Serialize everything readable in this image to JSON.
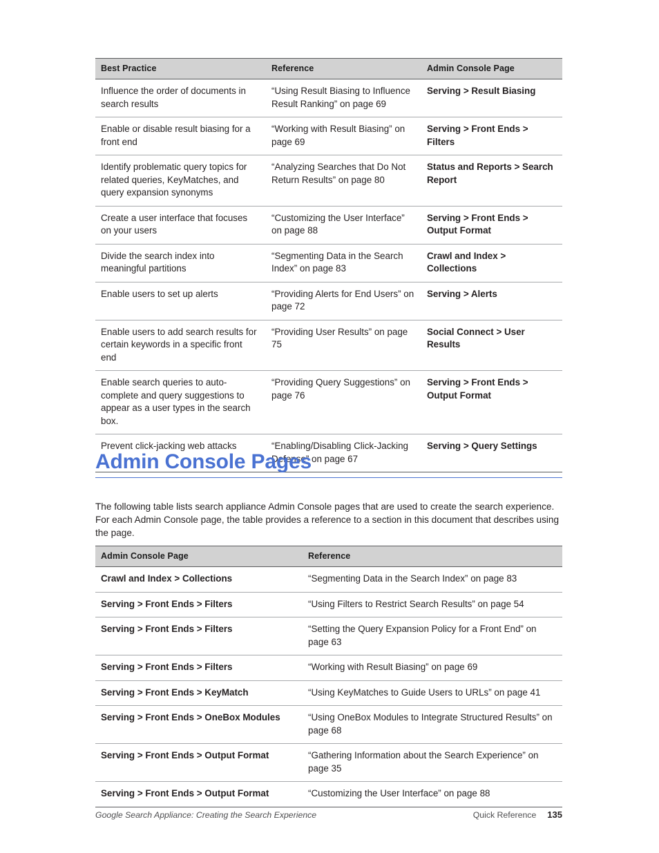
{
  "best_practice_table": {
    "columns": [
      "Best Practice",
      "Reference",
      "Admin Console Page"
    ],
    "rows": [
      {
        "best_practice": "Influence the order of documents in search results",
        "reference": "“Using Result Biasing to Influence Result Ranking” on page 69",
        "admin_console_page": "Serving > Result Biasing"
      },
      {
        "best_practice": "Enable or disable result biasing for a front end",
        "reference": "“Working with Result Biasing” on page 69",
        "admin_console_page": "Serving > Front Ends > Filters"
      },
      {
        "best_practice": "Identify problematic query topics for related queries, KeyMatches, and query expansion synonyms",
        "reference": "“Analyzing Searches that Do Not Return Results” on page 80",
        "admin_console_page": "Status and Reports > Search Report"
      },
      {
        "best_practice": "Create a user interface that focuses on your users",
        "reference": "“Customizing the User Interface” on page 88",
        "admin_console_page": "Serving > Front Ends > Output Format"
      },
      {
        "best_practice": "Divide the search index into meaningful partitions",
        "reference": "“Segmenting Data in the Search Index” on page 83",
        "admin_console_page": "Crawl and Index > Collections"
      },
      {
        "best_practice": "Enable users to set up alerts",
        "reference": "“Providing Alerts for End Users” on page 72",
        "admin_console_page": "Serving > Alerts"
      },
      {
        "best_practice": "Enable users to add search results for certain keywords in a specific front end",
        "reference": "“Providing User Results” on page 75",
        "admin_console_page": "Social Connect > User Results"
      },
      {
        "best_practice": "Enable search queries to auto-complete and query suggestions to appear as a user types in the search box.",
        "reference": "“Providing Query Suggestions” on page 76",
        "admin_console_page": "Serving > Front Ends > Output Format"
      },
      {
        "best_practice": "Prevent click-jacking web attacks",
        "reference": "“Enabling/Disabling Click-Jacking Defense” on page 67",
        "admin_console_page": "Serving > Query Settings"
      }
    ]
  },
  "section": {
    "heading": "Admin Console Pages",
    "intro": "The following table lists search appliance Admin Console pages that are used to create the search experience. For each Admin Console page, the table provides a reference to a section in this document that describes using the page."
  },
  "admin_console_table": {
    "columns": [
      "Admin Console Page",
      "Reference"
    ],
    "rows": [
      {
        "admin_console_page": "Crawl and Index > Collections",
        "reference": "“Segmenting Data in the Search Index” on page 83"
      },
      {
        "admin_console_page": "Serving > Front Ends > Filters",
        "reference": "“Using Filters to Restrict Search Results” on page 54"
      },
      {
        "admin_console_page": "Serving > Front Ends > Filters",
        "reference": "“Setting the Query Expansion Policy for a Front End” on page 63"
      },
      {
        "admin_console_page": "Serving > Front Ends > Filters",
        "reference": "“Working with Result Biasing” on page 69"
      },
      {
        "admin_console_page": "Serving > Front Ends > KeyMatch",
        "reference": "“Using KeyMatches to Guide Users to URLs” on page 41"
      },
      {
        "admin_console_page": "Serving > Front Ends > OneBox Modules",
        "reference": "“Using OneBox Modules to Integrate Structured Results” on page 68"
      },
      {
        "admin_console_page": "Serving > Front Ends > Output Format",
        "reference": "“Gathering Information about the Search Experience” on page 35"
      },
      {
        "admin_console_page": "Serving > Front Ends > Output Format",
        "reference": "“Customizing the User Interface” on page 88"
      }
    ]
  },
  "footer": {
    "doc_title": "Google Search Appliance: Creating the Search Experience",
    "section_label": "Quick Reference",
    "page_number": "135"
  },
  "colors": {
    "heading_blue": "#4a72d2",
    "table_header_bg": "#d2d2d2",
    "rule_dark": "#58595b",
    "rule_light": "#a7a9ac",
    "body_text": "#231f20"
  }
}
